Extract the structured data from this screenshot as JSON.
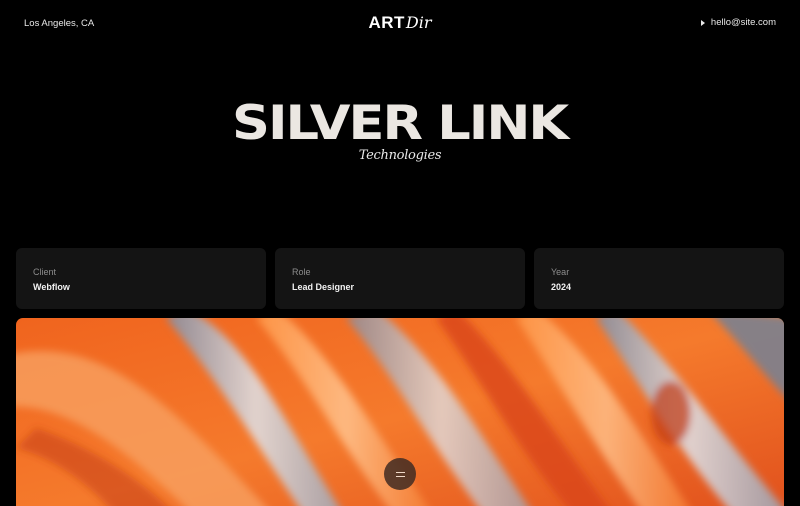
{
  "header": {
    "location": "Los Angeles, CA",
    "logo_primary": "ART",
    "logo_secondary": "Dir",
    "email": "hello@site.com"
  },
  "hero": {
    "title": "SILVER LINK",
    "subtitle": "Technologies"
  },
  "details": [
    {
      "label": "Client",
      "value": "Webflow"
    },
    {
      "label": "Role",
      "value": "Lead Designer"
    },
    {
      "label": "Year",
      "value": "2024"
    }
  ],
  "media": {
    "menu_icon": "menu-icon",
    "colors": {
      "orange": "#f26a22",
      "deep_orange": "#d9461a",
      "silver": "#c9ccd3",
      "steel": "#8d98aa"
    }
  },
  "colors": {
    "background": "#000000",
    "card": "#141414",
    "title": "#ebe7e2"
  }
}
